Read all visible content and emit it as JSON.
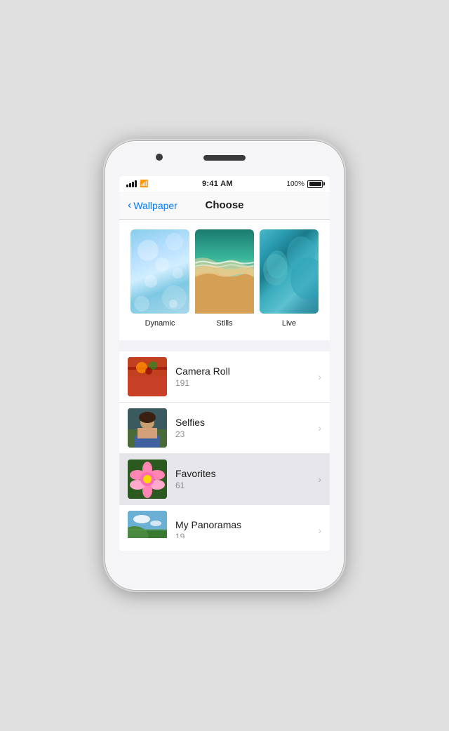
{
  "phone": {
    "status_bar": {
      "time": "9:41 AM",
      "battery_pct": "100%"
    },
    "nav": {
      "back_label": "Wallpaper",
      "title": "Choose"
    },
    "wallpaper_section": {
      "items": [
        {
          "id": "dynamic",
          "label": "Dynamic"
        },
        {
          "id": "stills",
          "label": "Stills"
        },
        {
          "id": "live",
          "label": "Live"
        }
      ]
    },
    "albums": [
      {
        "id": "camera-roll",
        "name": "Camera Roll",
        "count": "191"
      },
      {
        "id": "selfies",
        "name": "Selfies",
        "count": "23"
      },
      {
        "id": "favorites",
        "name": "Favorites",
        "count": "61",
        "highlighted": true
      },
      {
        "id": "panoramas",
        "name": "My Panoramas",
        "count": "19"
      }
    ]
  }
}
